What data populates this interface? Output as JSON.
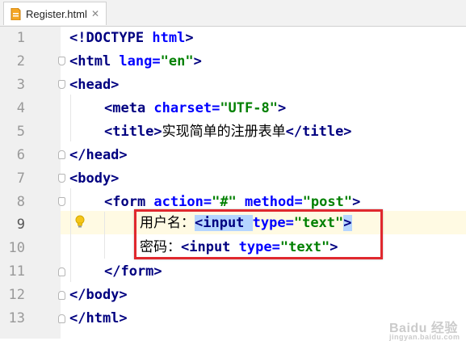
{
  "tab": {
    "label": "Register.html",
    "file_icon": "html-file-icon",
    "close_icon": "close-icon"
  },
  "gutter": {
    "line_numbers": [
      "1",
      "2",
      "3",
      "4",
      "5",
      "6",
      "7",
      "8",
      "9",
      "10",
      "11",
      "12",
      "13"
    ],
    "current_line": "9",
    "intention_icon": "lightbulb-icon"
  },
  "code": {
    "line1": {
      "t1": "<!DOCTYPE ",
      "t2": "html",
      "t3": ">"
    },
    "line2": {
      "t1": "<html ",
      "a1": "lang=",
      "s1": "\"en\"",
      "t2": ">"
    },
    "line3": {
      "t1": "<head>"
    },
    "line4": {
      "t1": "<meta ",
      "a1": "charset=",
      "s1": "\"UTF-8\"",
      "t2": ">"
    },
    "line5": {
      "t1": "<title>",
      "text": "实现简单的注册表单",
      "t2": "</title>"
    },
    "line6": {
      "t1": "</head>"
    },
    "line7": {
      "t1": "<body>"
    },
    "line8": {
      "t1": "<form ",
      "a1": "action=",
      "s1": "\"#\"",
      "a2": " method=",
      "s2": "\"post\"",
      "t2": ">"
    },
    "line9": {
      "label": "用户名：",
      "t1": "<input ",
      "a1": "type=",
      "s1": "\"text\"",
      "t2": ">"
    },
    "line10": {
      "label": "密码：",
      "t1": "<input ",
      "a1": "type=",
      "s1": "\"text\"",
      "t2": ">"
    },
    "line11": {
      "t1": "</form>"
    },
    "line12": {
      "t1": "</body>"
    },
    "line13": {
      "t1": "</html>"
    }
  },
  "watermark": {
    "text": "Baidu 经验",
    "sub": "jingyan.baidu.com"
  },
  "colors": {
    "tag": "#000080",
    "attribute": "#0000ff",
    "string": "#008000",
    "highlight_box": "#e0282e",
    "current_line": "#fffae3"
  }
}
